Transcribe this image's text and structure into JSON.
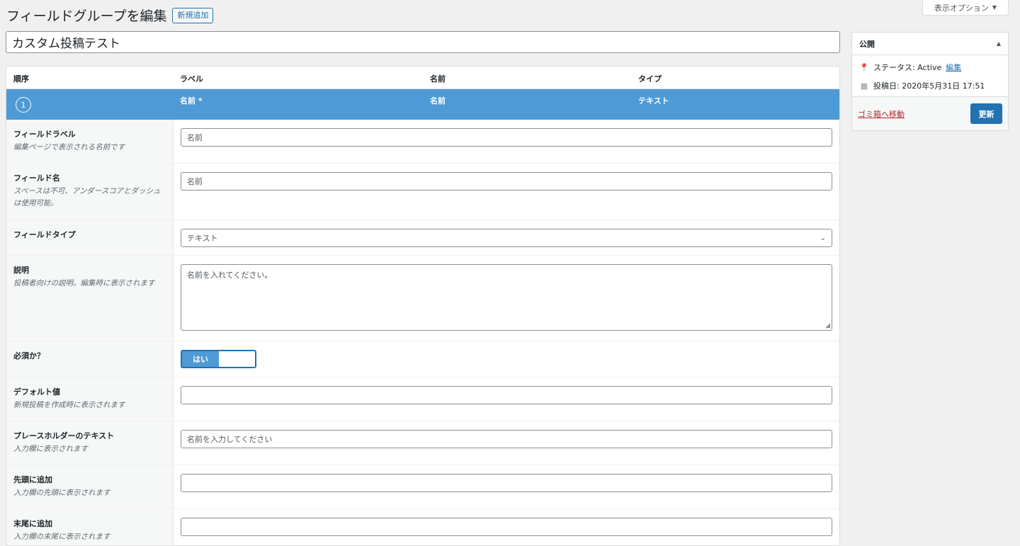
{
  "header": {
    "title": "フィールドグループを編集",
    "add_new_label": "新規追加",
    "screen_options_label": "表示オプション"
  },
  "group_title": "カスタム投稿テスト",
  "columns": {
    "order": "順序",
    "label": "ラベル",
    "name": "名前",
    "type": "タイプ"
  },
  "field": {
    "order": "1",
    "label": "名前 *",
    "name": "名前",
    "type": "テキスト"
  },
  "settings": {
    "field_label": {
      "label": "フィールドラベル",
      "desc": "編集ページで表示される名前です",
      "value": "名前"
    },
    "field_name": {
      "label": "フィールド名",
      "desc": "スペースは不可、アンダースコアとダッシュは使用可能。",
      "value": "名前"
    },
    "field_type": {
      "label": "フィールドタイプ",
      "value": "テキスト"
    },
    "description": {
      "label": "説明",
      "desc": "投稿者向けの説明。編集時に表示されます",
      "value": "名前を入れてください。"
    },
    "required": {
      "label": "必須か？",
      "toggle_label": "はい",
      "state": "on"
    },
    "default_value": {
      "label": "デフォルト値",
      "desc": "新規投稿を作成時に表示されます",
      "value": ""
    },
    "placeholder": {
      "label": "プレースホルダーのテキスト",
      "desc": "入力欄に表示されます",
      "value": "名前を入力してください"
    },
    "prepend": {
      "label": "先頭に追加",
      "desc": "入力欄の先頭に表示されます",
      "value": ""
    },
    "append": {
      "label": "末尾に追加",
      "desc": "入力欄の末尾に表示されます",
      "value": ""
    }
  },
  "publish": {
    "title": "公開",
    "status_label": "ステータス: Active",
    "status_edit": "編集",
    "date_label": "投稿日: 2020年5月31日 17:51",
    "trash_label": "ゴミ箱へ移動",
    "update_label": "更新"
  },
  "colors": {
    "accent": "#2271b1",
    "row_highlight": "#4d9ad6",
    "trash": "#b32d2e"
  }
}
